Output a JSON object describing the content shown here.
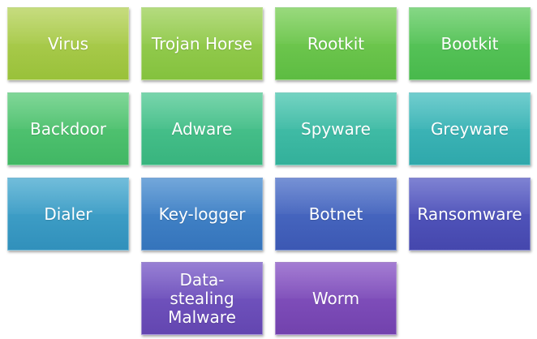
{
  "tiles": [
    {
      "label": "Virus",
      "color_top": "#b6d25a",
      "color_bottom": "#99c13a"
    },
    {
      "label": "Trojan Horse",
      "color_top": "#9fd15a",
      "color_bottom": "#84c23e"
    },
    {
      "label": "Rootkit",
      "color_top": "#7ccf58",
      "color_bottom": "#5dbc42"
    },
    {
      "label": "Bootkit",
      "color_top": "#63cc63",
      "color_bottom": "#48b94c"
    },
    {
      "label": "Backdoor",
      "color_top": "#5ccb7a",
      "color_bottom": "#41b764"
    },
    {
      "label": "Adware",
      "color_top": "#52c994",
      "color_bottom": "#38b47e"
    },
    {
      "label": "Spyware",
      "color_top": "#4cc6b0",
      "color_bottom": "#33b09a"
    },
    {
      "label": "Greyware",
      "color_top": "#48bfc0",
      "color_bottom": "#2fa8ab"
    },
    {
      "label": "Dialer",
      "color_top": "#49aad0",
      "color_bottom": "#3190bb"
    },
    {
      "label": "Key-logger",
      "color_top": "#4b8ed0",
      "color_bottom": "#3574bb"
    },
    {
      "label": "Botnet",
      "color_top": "#4f72c9",
      "color_bottom": "#3c58b3"
    },
    {
      "label": "Ransomware",
      "color_top": "#5a5fc6",
      "color_bottom": "#4547ad"
    },
    {
      "label": "Data-\nstealing\nMalware",
      "color_top": "#7a5cc8",
      "color_bottom": "#6346b0"
    },
    {
      "label": "Worm",
      "color_top": "#8a58c6",
      "color_bottom": "#7242ad"
    }
  ]
}
